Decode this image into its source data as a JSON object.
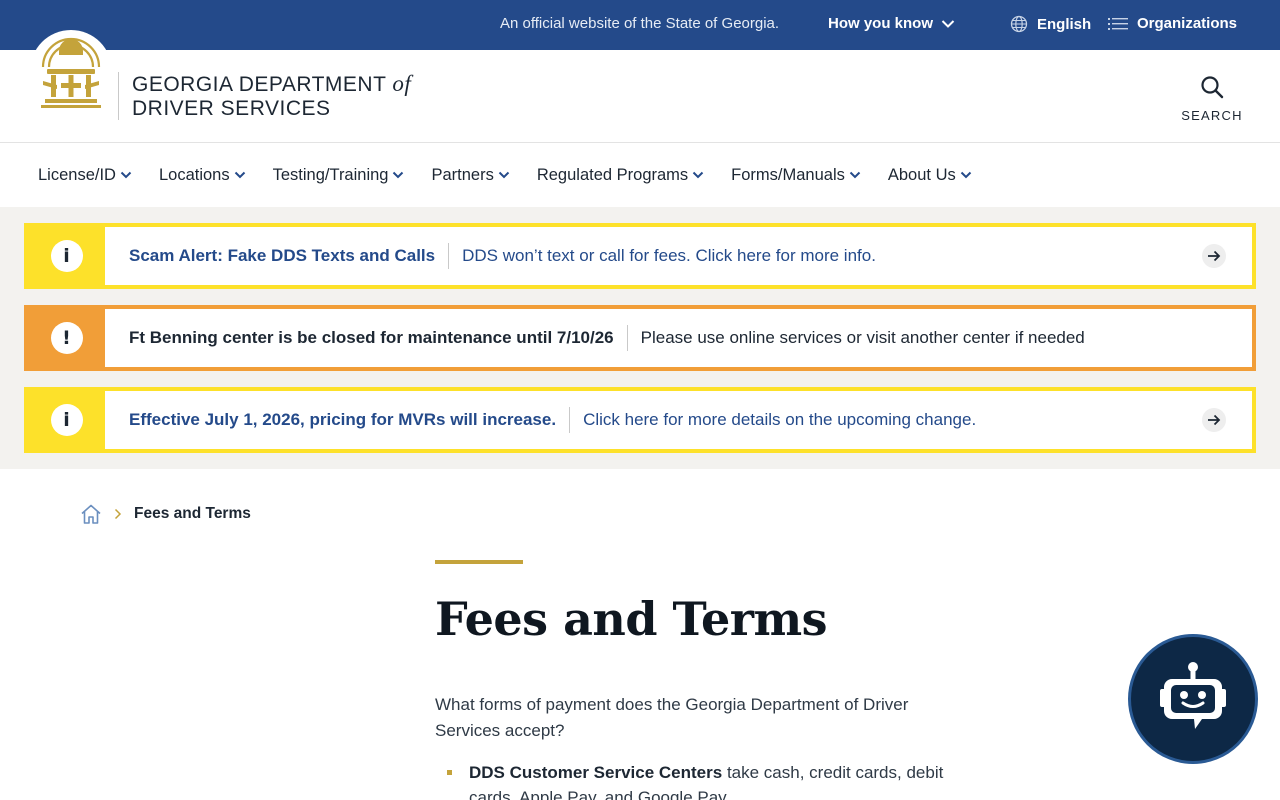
{
  "topbar": {
    "official_text": "An official website of the State of Georgia.",
    "how_you_know": "How you know",
    "language": "English",
    "organizations": "Organizations"
  },
  "header": {
    "brand_line1": "GEORGIA DEPARTMENT",
    "brand_of": "of",
    "brand_line2": "DRIVER SERVICES",
    "search_label": "SEARCH"
  },
  "nav": {
    "items": [
      {
        "label": "License/ID"
      },
      {
        "label": "Locations"
      },
      {
        "label": "Testing/Training"
      },
      {
        "label": "Partners"
      },
      {
        "label": "Regulated Programs"
      },
      {
        "label": "Forms/Manuals"
      },
      {
        "label": "About Us"
      }
    ]
  },
  "alerts": [
    {
      "icon": "i",
      "title": "Scam Alert: Fake DDS Texts and Calls",
      "description": "DDS won’t text or call for fees. Click here for more info."
    },
    {
      "icon": "!",
      "title": "Ft Benning center is be closed for maintenance until 7/10/26",
      "description": "Please use online services or visit another center if needed"
    },
    {
      "icon": "i",
      "title": "Effective July 1, 2026, pricing for MVRs will increase.",
      "description": "Click here for more details on the upcoming change."
    }
  ],
  "breadcrumb": {
    "current": "Fees and Terms"
  },
  "main": {
    "title": "Fees and Terms",
    "intro": "What forms of payment does the Georgia Department of Driver Services accept?",
    "bullets": [
      {
        "bold": "DDS Customer Service Centers",
        "text": " take cash, credit cards, debit cards, Apple Pay, and Google Pay."
      }
    ]
  },
  "colors": {
    "banner_blue": "#244a8a",
    "alert_yellow": "#fde12a",
    "alert_orange": "#f19e38",
    "accent_gold": "#c4a33b",
    "chatbot_navy": "#0d2846"
  }
}
